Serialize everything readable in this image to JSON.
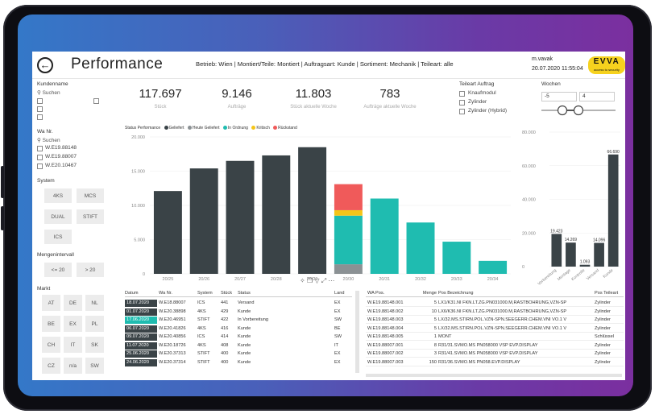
{
  "header": {
    "title": "Performance",
    "filters": "Betrieb: Wien | Montiert/Teile: Montiert | Auftragsart: Kunde | Sortiment: Mechanik | Teileart: alle",
    "user": "m.vavak",
    "datetime": "20.07.2020 11:55:04",
    "logo": "EVVA",
    "logo_sub": "access to security"
  },
  "sidebar": {
    "kundenname_label": "Kundenname",
    "search_placeholder": "Suchen",
    "wanr_label": "Wa Nr.",
    "wanr_items": [
      "W.E19.88148",
      "W.E19.88007",
      "W.E20.10467"
    ],
    "system_label": "System",
    "system_tiles": [
      "4KS",
      "MCS",
      "DUAL",
      "STIFT",
      "ICS"
    ],
    "menge_label": "Mengenintervall",
    "menge_tiles": [
      "<= 20",
      "> 20"
    ],
    "markt_label": "Markt",
    "markt_tiles": [
      "AT",
      "DE",
      "NL",
      "BE",
      "EX",
      "PL",
      "CH",
      "IT",
      "SK",
      "CZ",
      "n/a",
      "SW"
    ]
  },
  "kpis": [
    {
      "value": "117.697",
      "label": "Stück"
    },
    {
      "value": "9.146",
      "label": "Aufträge"
    },
    {
      "value": "11.803",
      "label": "Stück aktuelle Woche"
    },
    {
      "value": "783",
      "label": "Aufträge aktuelle Woche"
    }
  ],
  "teileart": {
    "label": "Teileart Auftrag",
    "options": [
      "Knaufmodul",
      "Zylinder",
      "Zylinder (Hybrid)"
    ]
  },
  "wochen": {
    "label": "Wochen",
    "from": "-5",
    "to": "4",
    "slider_from": 0.25,
    "slider_to": 0.5
  },
  "legend": {
    "title": "Status Performance",
    "items": [
      {
        "name": "Geliefert",
        "color": "#3a4347"
      },
      {
        "name": "Heute Geliefert",
        "color": "#8b9194"
      },
      {
        "name": "In Ordnung",
        "color": "#1fbcb0"
      },
      {
        "name": "Kritisch",
        "color": "#f5c518"
      },
      {
        "name": "Rückstand",
        "color": "#f05a5a"
      }
    ]
  },
  "chart_data": [
    {
      "type": "bar",
      "stacked": true,
      "categories": [
        "20/25",
        "20/26",
        "20/27",
        "20/28",
        "20/29",
        "20/30",
        "20/31",
        "20/32",
        "20/33",
        "20/34"
      ],
      "series": [
        {
          "name": "Geliefert",
          "color": "#3a4347",
          "values": [
            12100,
            15400,
            16500,
            17300,
            18500,
            0,
            0,
            0,
            0,
            0
          ]
        },
        {
          "name": "Heute Geliefert",
          "color": "#8b9194",
          "values": [
            0,
            0,
            0,
            0,
            0,
            1400,
            0,
            0,
            0,
            0
          ]
        },
        {
          "name": "In Ordnung",
          "color": "#1fbcb0",
          "values": [
            0,
            0,
            0,
            0,
            0,
            7100,
            11000,
            7500,
            4700,
            1900
          ]
        },
        {
          "name": "Kritisch",
          "color": "#f5c518",
          "values": [
            0,
            0,
            0,
            0,
            0,
            800,
            0,
            0,
            0,
            0
          ]
        },
        {
          "name": "Rückstand",
          "color": "#f05a5a",
          "values": [
            0,
            0,
            0,
            0,
            0,
            3800,
            0,
            0,
            0,
            0
          ]
        }
      ],
      "yticks": [
        "0",
        "5.000",
        "10.000",
        "15.000",
        "20.000"
      ],
      "ylim": [
        0,
        20000
      ]
    },
    {
      "type": "bar",
      "categories": [
        "Vorbereitung",
        "Montage",
        "Kontrolle",
        "Versand",
        "Kunde"
      ],
      "values": [
        19423,
        14269,
        1093,
        14096,
        66690
      ],
      "labels": [
        "19.423",
        "14.269",
        "1.093",
        "14.096",
        "66.690"
      ],
      "yticks": [
        "0",
        "20.000",
        "40.000",
        "60.000",
        "80.000"
      ],
      "ylim": [
        0,
        80000
      ]
    }
  ],
  "orders_table": {
    "columns": [
      "Datum",
      "Wa Nr.",
      "System",
      "Stück",
      "Status",
      "Land"
    ],
    "rows": [
      [
        "18.07.2020",
        "W.E18.88007",
        "ICS",
        "441",
        "Versand",
        "EX"
      ],
      [
        "01.07.2020",
        "W.E20.38898",
        "4KS",
        "429",
        "Kunde",
        "EX"
      ],
      [
        "17.06.2020",
        "W.E20.46951",
        "STIFT",
        "422",
        "In Vorbereitung",
        "SW"
      ],
      [
        "06.07.2020",
        "W.E20.41826",
        "4KS",
        "416",
        "Kunde",
        "BE"
      ],
      [
        "09.07.2020",
        "W.E20.40856",
        "ICS",
        "414",
        "Kunde",
        "SW"
      ],
      [
        "11.07.2020",
        "W.E20.18726",
        "4KS",
        "408",
        "Kunde",
        "IT"
      ],
      [
        "25.06.2020",
        "W.E20.37313",
        "STIFT",
        "400",
        "Kunde",
        "EX"
      ],
      [
        "24.06.2020",
        "W.E20.37314",
        "STIFT",
        "400",
        "Kunde",
        "EX"
      ]
    ]
  },
  "positions_table": {
    "columns": [
      "WA Pos.",
      "Menge",
      "Pos Bezeichnung",
      "Pos Teileart"
    ],
    "rows": [
      [
        "W.E19.88148.001",
        "5",
        "LX1/K31.NI FKN.LT.ZG.PN031000.M,RASTBOHRUNG,VZN-SP",
        "Zylinder"
      ],
      [
        "W.E19.88148.002",
        "10",
        "LX6/K36.NI FKN.LT.ZG.PN031000.M,RASTBOHRUNG,VZN-SP",
        "Zylinder"
      ],
      [
        "W.E19.88148.003",
        "5",
        "LX/32.MS.STIRN.POL.VZN-SPN.SEEGERR.CHEM.VNI VO.1 V",
        "Zylinder"
      ],
      [
        "W.E19.88148.004",
        "5",
        "LX/32.MS.STIRN.POL.VZN-SPN.SEEGERR.CHEM.VNI VO.1 V",
        "Zylinder"
      ],
      [
        "W.E19.88148.005",
        "1",
        "MONT",
        "Schlüssel"
      ],
      [
        "W.E19.88007.001",
        "8",
        "R31/31.SVMO.MS PN058000 VSP EVP.DISPLAY",
        "Zylinder"
      ],
      [
        "W.E19.88007.002",
        "3",
        "R31/41.SVMO.MS PN058000 VSP EVP.DISPLAY",
        "Zylinder"
      ],
      [
        "W.E19.88007.003",
        "150",
        "R31/36.SVMO.MS PN058.EVP.DISPLAY",
        "Zylinder"
      ]
    ]
  },
  "chart_icons": {
    "pin": "pin-icon",
    "copy": "copy-icon",
    "filter": "filter-icon",
    "focus": "focus-icon",
    "more": "more-icon"
  }
}
